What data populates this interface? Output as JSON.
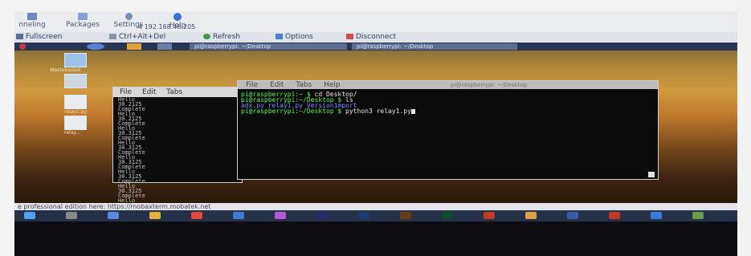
{
  "host_toolbar": {
    "items": [
      {
        "label": "nneling",
        "icon": "monitor-icon"
      },
      {
        "label": "Packages",
        "icon": "packages-icon"
      },
      {
        "label": "Settings",
        "icon": "settings-icon"
      },
      {
        "label": "Help",
        "icon": "help-icon"
      }
    ],
    "ip": "4 192.168.46.205"
  },
  "vnc_toolbar": {
    "items": [
      {
        "label": "Fullscreen",
        "icon": "fullscreen-icon"
      },
      {
        "label": "Ctrl+Alt+Del",
        "icon": "keyboard-icon"
      },
      {
        "label": "Refresh",
        "icon": "refresh-icon"
      },
      {
        "label": "Options",
        "icon": "options-icon"
      },
      {
        "label": "Disconnect",
        "icon": "disconnect-icon"
      }
    ]
  },
  "remote_taskbar": {
    "tabs": [
      "pi@raspberrypi: ~/Desktop",
      "pi@raspberrypi: ~/Desktop"
    ]
  },
  "desktop_icons": [
    {
      "label": "Wastebasket"
    },
    {
      "label": ""
    },
    {
      "label": "relay1.py"
    },
    {
      "label": "relay..."
    }
  ],
  "terminal_back": {
    "menu": [
      "File",
      "Edit",
      "Tabs"
    ],
    "lines": [
      "Hello",
      "30.2125",
      "Complete",
      "Hello",
      "30.2125",
      "Complete",
      "Hello",
      "30.3125",
      "Complete",
      "Hello",
      "30.3125",
      "Complete",
      "Hello",
      "30.3125",
      "Complete",
      "Hello",
      "30.3125",
      "Complete",
      "Hello",
      "30.3125",
      "Complete",
      "Hello",
      "30.3125"
    ]
  },
  "terminal_front": {
    "menu": [
      "File",
      "Edit",
      "Tabs",
      "Help"
    ],
    "window_title": "pi@raspberrypi: ~/Desktop",
    "lines": [
      {
        "prompt": "pi@raspberrypi:~ $",
        "cmd": " cd Desktop/"
      },
      {
        "prompt": "pi@raspberrypi:~/Desktop $",
        "cmd": " ls"
      },
      {
        "prompt": "",
        "cmd": "adx.py  relay1.py  Version1mport"
      },
      {
        "prompt": "pi@raspberrypi:~/Desktop $",
        "cmd": " python3 relay1.py"
      }
    ]
  },
  "url_bar": {
    "text": "e professional edition here: https://mobaxterm.mobatek.net"
  },
  "host_apps": [
    "windows",
    "search",
    "task-view",
    "explorer",
    "chrome",
    "edge",
    "firefox",
    "pr",
    "ps",
    "ai",
    "dw",
    "f",
    "cc",
    "vnc",
    "youtube",
    "edge2",
    "photos"
  ],
  "bottom_text": "..."
}
